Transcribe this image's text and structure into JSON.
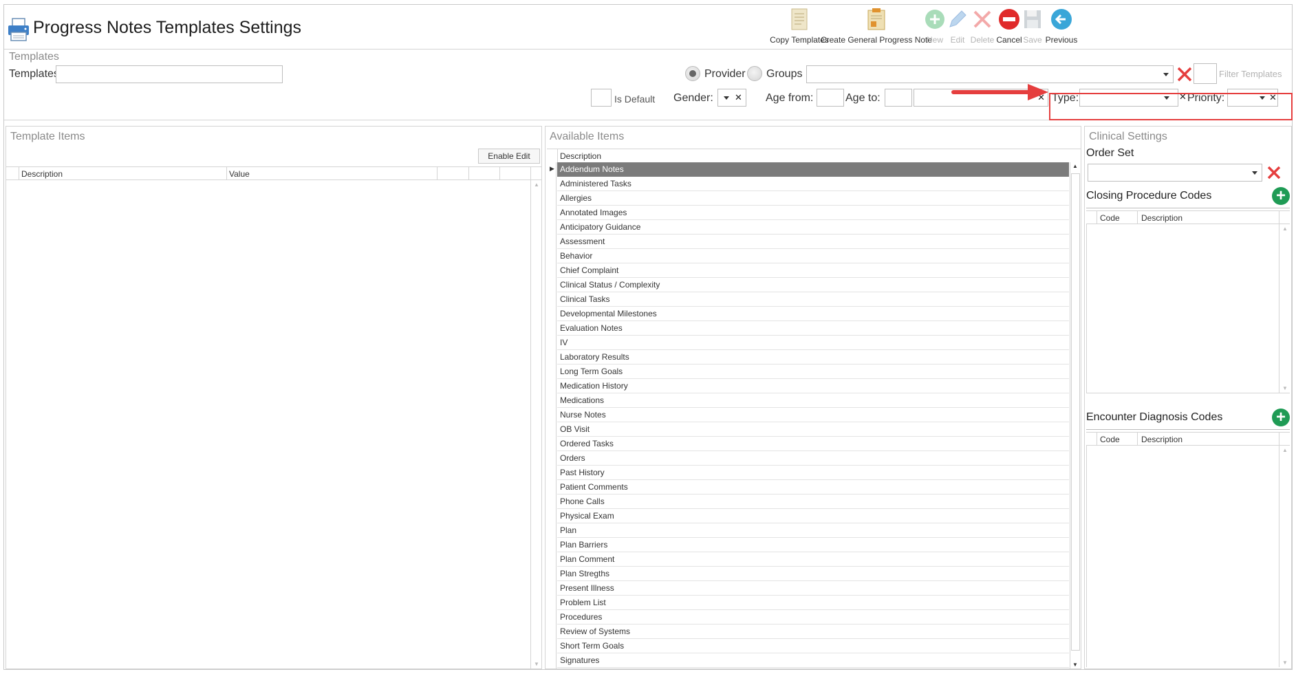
{
  "title": "Progress Notes Templates Settings",
  "toolbar": {
    "copy_templates": "Copy Templates",
    "create_general": "Create General Progress Note",
    "new": "New",
    "edit": "Edit",
    "delete": "Delete",
    "cancel": "Cancel",
    "save": "Save",
    "previous": "Previous"
  },
  "filters": {
    "section_title": "Templates",
    "templates_label": "Templates:",
    "provider_label": "Provider",
    "groups_label": "Groups",
    "filter_placeholder": "Filter Templates",
    "is_default_label": "Is Default",
    "gender_label": "Gender:",
    "age_from_label": "Age from:",
    "age_to_label": "Age to:",
    "type_label": "Type:",
    "priority_label": "Priority:"
  },
  "template_items": {
    "title": "Template Items",
    "enable_edit": "Enable Edit",
    "col_description": "Description",
    "col_value": "Value"
  },
  "available_items": {
    "title": "Available Items",
    "col_description": "Description",
    "rows": [
      "Addendum Notes",
      "Administered Tasks",
      "Allergies",
      "Annotated Images",
      "Anticipatory Guidance",
      "Assessment",
      "Behavior",
      "Chief Complaint",
      "Clinical Status / Complexity",
      "Clinical Tasks",
      "Developmental Milestones",
      "Evaluation Notes",
      "IV",
      "Laboratory Results",
      "Long Term Goals",
      "Medication History",
      "Medications",
      "Nurse Notes",
      "OB Visit",
      "Ordered Tasks",
      "Orders",
      "Past History",
      "Patient Comments",
      "Phone Calls",
      "Physical Exam",
      "Plan",
      "Plan Barriers",
      "Plan Comment",
      "Plan Stregths",
      "Present Illness",
      "Problem List",
      "Procedures",
      "Review of Systems",
      "Short Term Goals",
      "Signatures"
    ],
    "selected_row": "Addendum Notes"
  },
  "clinical_settings": {
    "title": "Clinical Settings",
    "order_set_label": "Order Set",
    "closing_codes_title": "Closing Procedure Codes",
    "encounter_codes_title": "Encounter Diagnosis Codes",
    "col_code": "Code",
    "col_description": "Description"
  },
  "colors": {
    "accent_red": "#e53e3e",
    "green": "#1f9b55",
    "selected_row": "#7b7b7b"
  }
}
